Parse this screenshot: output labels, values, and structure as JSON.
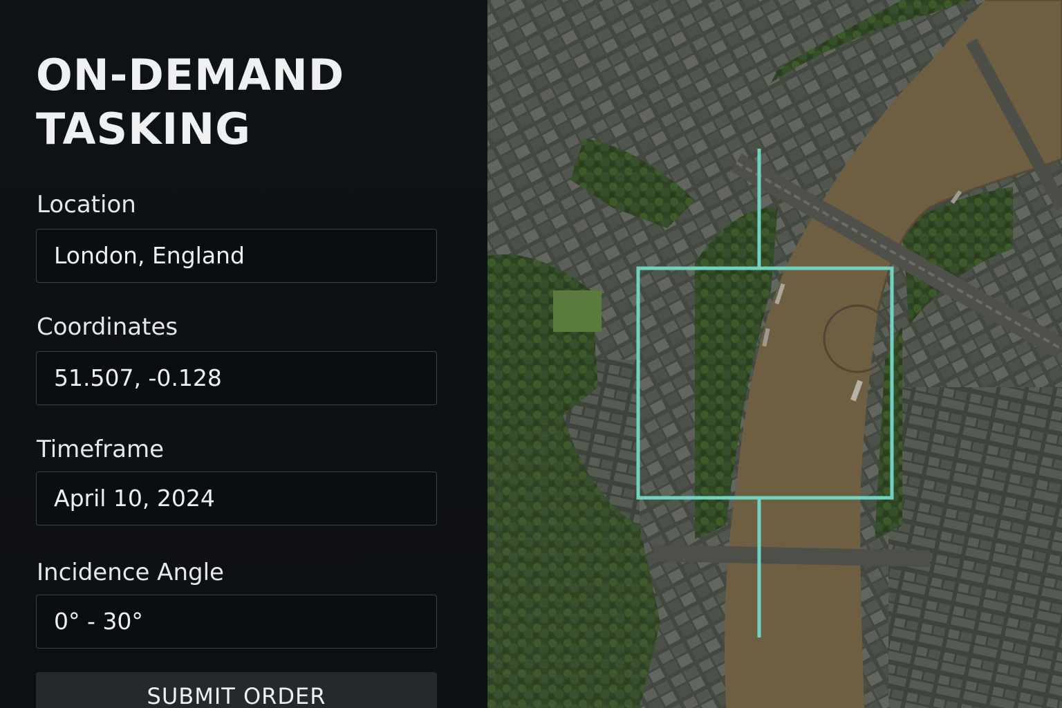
{
  "form": {
    "title_line1": "ON-DEMAND",
    "title_line2": "TASKING",
    "location": {
      "label": "Location",
      "value": "London, England"
    },
    "coordinates": {
      "label": "Coordinates",
      "value": "51.507, -0.128"
    },
    "timeframe": {
      "label": "Timeframe",
      "value": "April 10, 2024"
    },
    "incidence_angle": {
      "label": "Incidence Angle",
      "value": "0° - 30°"
    },
    "submit_label": "SUBMIT ORDER"
  },
  "map": {
    "imagery": "satellite-aerial-london-thames",
    "aoi_color": "#6fd3c0"
  }
}
